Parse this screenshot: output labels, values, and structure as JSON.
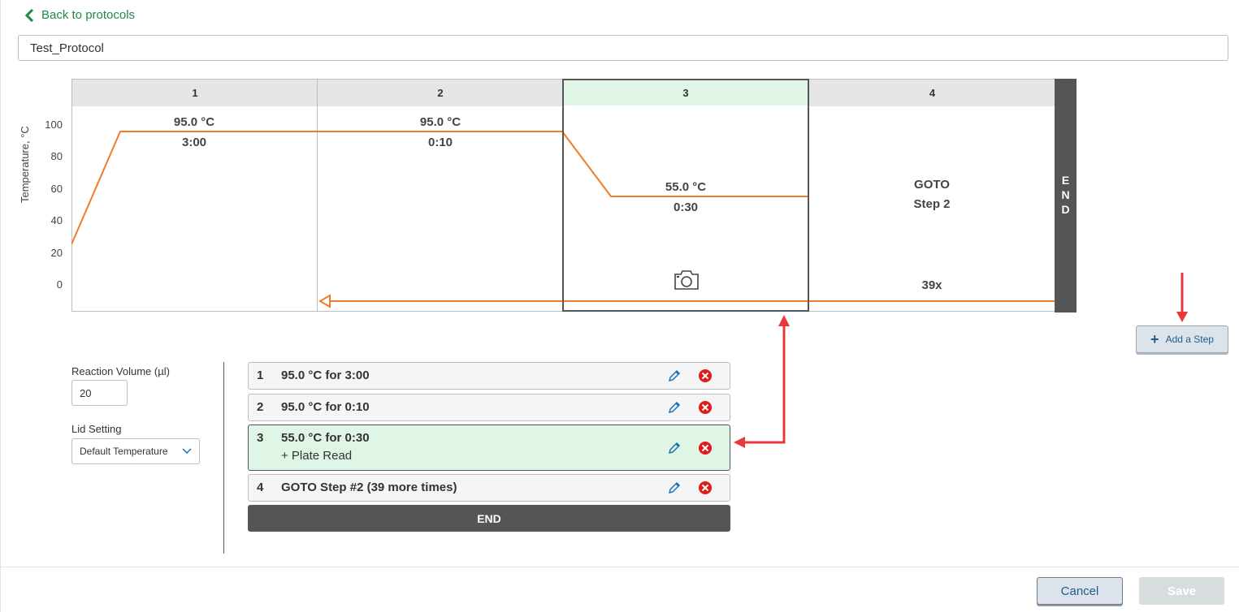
{
  "nav": {
    "back_label": "Back to protocols"
  },
  "protocol": {
    "name": "Test_Protocol"
  },
  "chart": {
    "y_axis_title": "Temperature, °C",
    "y_ticks": [
      "100",
      "80",
      "60",
      "40",
      "20",
      "0"
    ],
    "columns": [
      {
        "header": "1",
        "temp": "95.0 °C",
        "time": "3:00"
      },
      {
        "header": "2",
        "temp": "95.0 °C",
        "time": "0:10"
      },
      {
        "header": "3",
        "temp": "55.0 °C",
        "time": "0:30",
        "selected": true,
        "icon": "camera-icon"
      },
      {
        "header": "4",
        "goto_line1": "GOTO",
        "goto_line2": "Step 2",
        "cycles": "39x"
      }
    ],
    "end_letters": [
      "E",
      "N",
      "D"
    ],
    "line_color": "#f07c28",
    "selected_color": "#dff5e6"
  },
  "add_step_label": "Add a Step",
  "settings": {
    "volume_label": "Reaction Volume (µl)",
    "volume_value": "20",
    "lid_label": "Lid Setting",
    "lid_value": "Default Temperature"
  },
  "steps": [
    {
      "num": "1",
      "text": "95.0 °C for 3:00"
    },
    {
      "num": "2",
      "text": "95.0 °C for 0:10"
    },
    {
      "num": "3",
      "text": "55.0 °C for 0:30",
      "sub": "+ Plate Read",
      "selected": true
    },
    {
      "num": "4",
      "text": "GOTO Step #2 (39 more times)"
    }
  ],
  "end_label": "END",
  "footer": {
    "cancel_label": "Cancel",
    "save_label": "Save"
  },
  "colors": {
    "accent_green": "#1f8a45",
    "annotation_red": "#e8383d",
    "delete_red": "#e01b1b",
    "edit_blue": "#1a6fb5"
  }
}
